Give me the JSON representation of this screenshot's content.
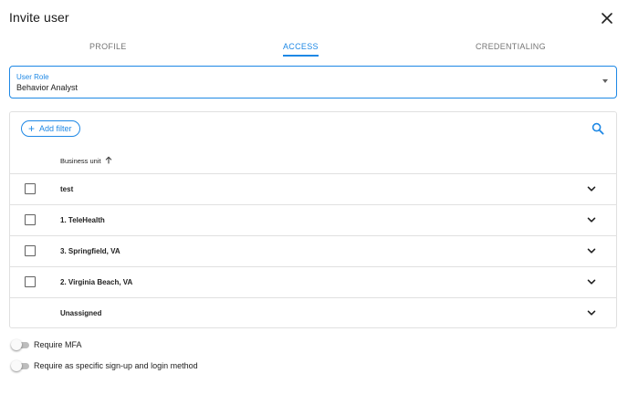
{
  "dialog": {
    "title": "Invite user"
  },
  "tabs": [
    {
      "label": "PROFILE",
      "active": false
    },
    {
      "label": "ACCESS",
      "active": true
    },
    {
      "label": "CREDENTIALING",
      "active": false
    }
  ],
  "user_role": {
    "label": "User Role",
    "value": "Behavior Analyst"
  },
  "toolbar": {
    "add_filter_label": "Add filter"
  },
  "table": {
    "column_header": "Business unit",
    "sort_direction": "ascending",
    "rows": [
      {
        "name": "test",
        "has_checkbox": true
      },
      {
        "name": "1. TeleHealth",
        "has_checkbox": true
      },
      {
        "name": "3. Springfield, VA",
        "has_checkbox": true
      },
      {
        "name": "2. Virginia Beach, VA",
        "has_checkbox": true
      },
      {
        "name": "Unassigned",
        "has_checkbox": false
      }
    ]
  },
  "toggles": {
    "mfa_label": "Require MFA",
    "mfa_on": false,
    "signup_label": "Require as specific sign-up and login method",
    "signup_on": false
  },
  "colors": {
    "accent": "#1e88e5",
    "border": "#e0e0e0",
    "text": "#212121",
    "muted": "#757575"
  },
  "icons": {
    "close": "close-icon",
    "caret": "caret-down-icon",
    "plus": "plus-icon",
    "search": "search-icon",
    "sort": "arrow-up-icon",
    "expand": "chevron-down-icon"
  }
}
